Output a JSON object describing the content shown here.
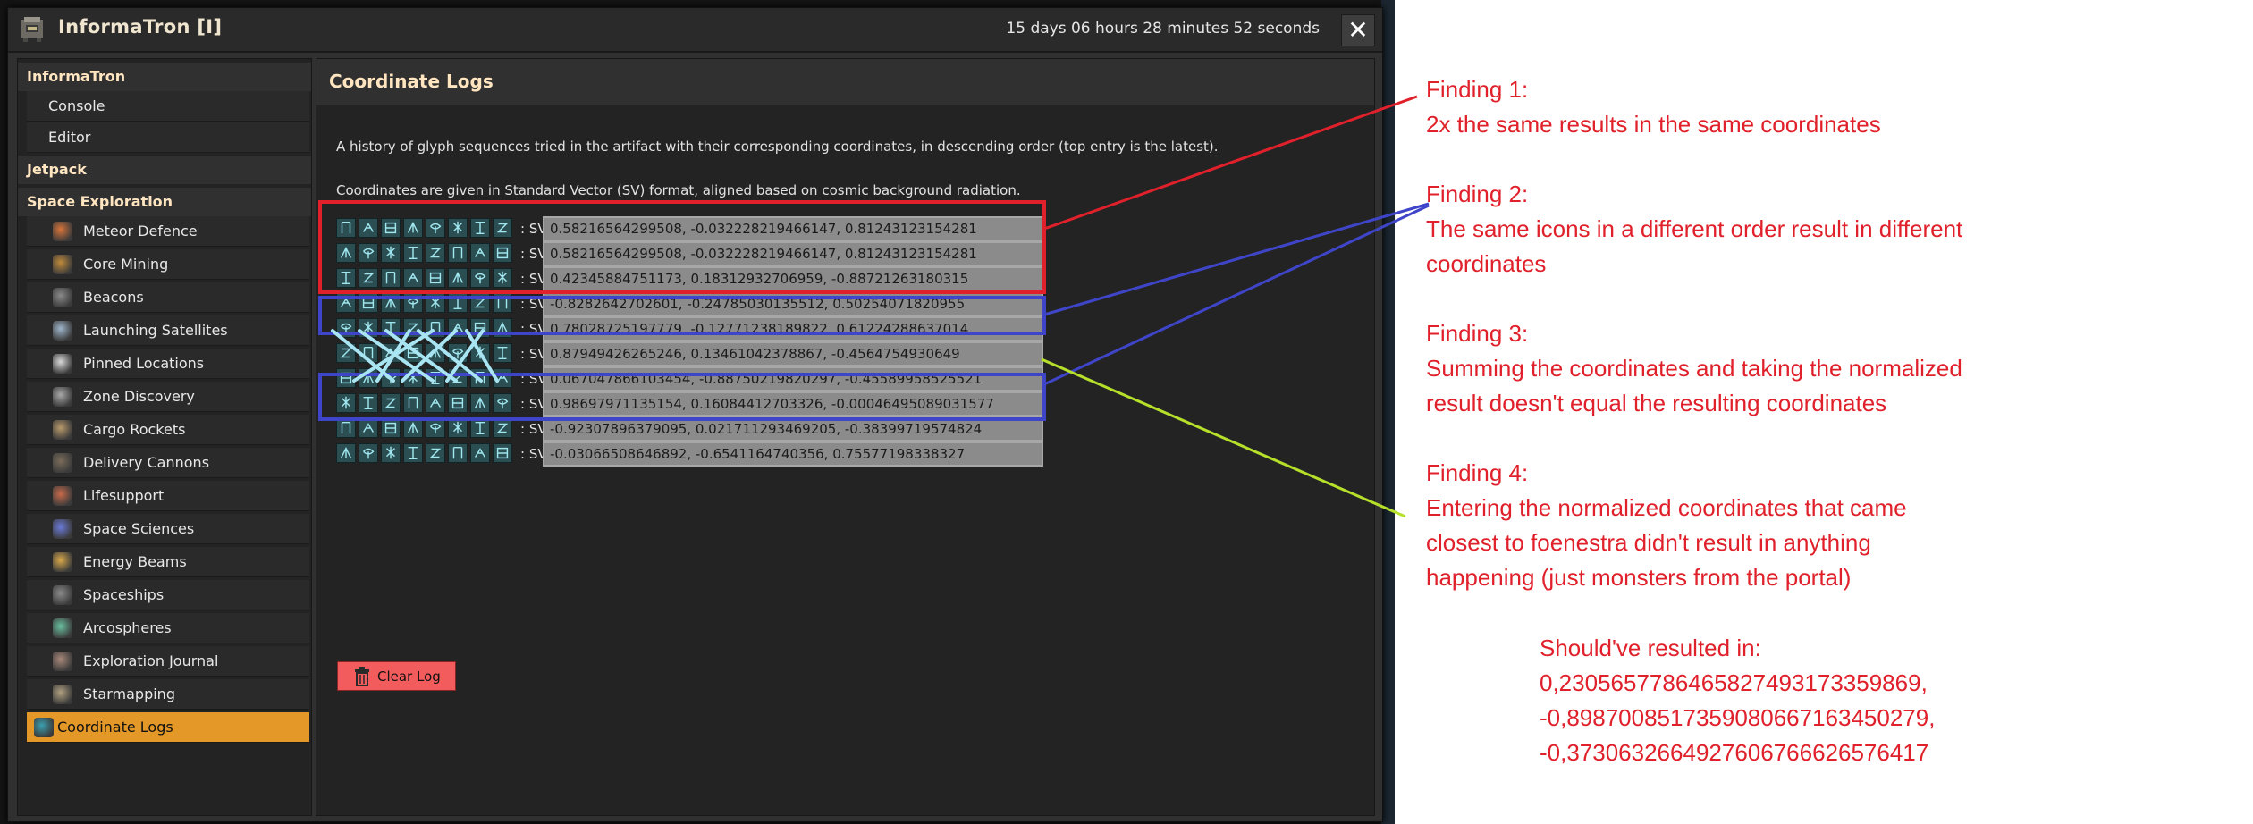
{
  "window": {
    "title": "InformaTron [I]",
    "timer": "15 days 06 hours 28 minutes 52 seconds",
    "close_glyph": "✕"
  },
  "sidebar": {
    "categories": [
      {
        "label": "InformaTron"
      },
      {
        "label": "Jetpack"
      },
      {
        "label": "Space Exploration"
      }
    ],
    "items": [
      {
        "label": "Console",
        "icon": "none"
      },
      {
        "label": "Editor",
        "icon": "none"
      },
      {
        "label": "Meteor Defence",
        "icon": "meteor-icon"
      },
      {
        "label": "Core Mining",
        "icon": "core-mining-icon"
      },
      {
        "label": "Beacons",
        "icon": "beacon-icon"
      },
      {
        "label": "Launching Satellites",
        "icon": "satellite-icon"
      },
      {
        "label": "Pinned Locations",
        "icon": "pin-icon"
      },
      {
        "label": "Zone Discovery",
        "icon": "planet-ring-icon"
      },
      {
        "label": "Cargo Rockets",
        "icon": "rocket-icon"
      },
      {
        "label": "Delivery Cannons",
        "icon": "cannon-icon"
      },
      {
        "label": "Lifesupport",
        "icon": "lifesupport-icon"
      },
      {
        "label": "Space Sciences",
        "icon": "science-pack-icon"
      },
      {
        "label": "Energy Beams",
        "icon": "energy-beam-icon"
      },
      {
        "label": "Spaceships",
        "icon": "spaceship-icon"
      },
      {
        "label": "Arcospheres",
        "icon": "arcosphere-icon"
      },
      {
        "label": "Exploration Journal",
        "icon": "journal-icon"
      },
      {
        "label": "Starmapping",
        "icon": "starmap-icon"
      },
      {
        "label": "Coordinate Logs",
        "icon": "coordinate-log-icon",
        "active": true
      }
    ]
  },
  "content": {
    "title": "Coordinate Logs",
    "intro": "A history of glyph sequences tried in the artifact with their corresponding coordinates, in descending order (top entry is the latest).",
    "format_note": "Coordinates are given in Standard Vector (SV) format, aligned based on cosmic background radiation.",
    "sv_label": ": SV",
    "rows": [
      {
        "value": "0.58216564299508, -0.032228219466147, 0.81243123154281"
      },
      {
        "value": "0.58216564299508, -0.032228219466147, 0.81243123154281"
      },
      {
        "value": "0.42345884751173, 0.18312932706959, -0.88721263180315"
      },
      {
        "value": "-0.8282642702601, -0.24785030135512, 0.50254071820955"
      },
      {
        "value": "0.78028725197779, -0.12771238189822, 0.61224288637014"
      },
      {
        "value": "0.87949426265246, 0.13461042378867, -0.4564754930649"
      },
      {
        "value": "0.067047866103454, -0.88750219820297, -0.45589958525521"
      },
      {
        "value": "0.98697971135154, 0.16084412703326, -0.00046495089031577"
      },
      {
        "value": "-0.92307896379095, 0.021711293469205, -0.38399719574824"
      },
      {
        "value": "-0.03066508646892, -0.6541164740356, 0.75577198338327"
      }
    ],
    "clear_button": "Clear Log"
  },
  "annotations": {
    "finding1": [
      "Finding 1:",
      "2x the same results in the same coordinates"
    ],
    "finding2": [
      "Finding 2:",
      "The same icons in a different order result in different",
      "coordinates"
    ],
    "finding3": [
      "Finding 3:",
      "Summing the coordinates and taking the normalized",
      "result doesn't equal the resulting coordinates"
    ],
    "finding4": [
      "Finding 4:",
      "Entering the normalized coordinates that came",
      "closest to foenestra didn't result in anything",
      "happening (just monsters from the portal)"
    ],
    "expected": [
      "Should've resulted in:",
      "0,23056577864658274931733598​69,",
      "-0,89870085173590806671634502​79,",
      "-0,37306326649276067666265764​17"
    ]
  },
  "colors": {
    "highlight_red": "#e0202a",
    "highlight_blue": "#3f45c8",
    "highlight_lime": "#b6e02a",
    "cross_lines": "#a8e4f2",
    "active_tab": "#e39827",
    "clear_button": "#f25c5c"
  }
}
